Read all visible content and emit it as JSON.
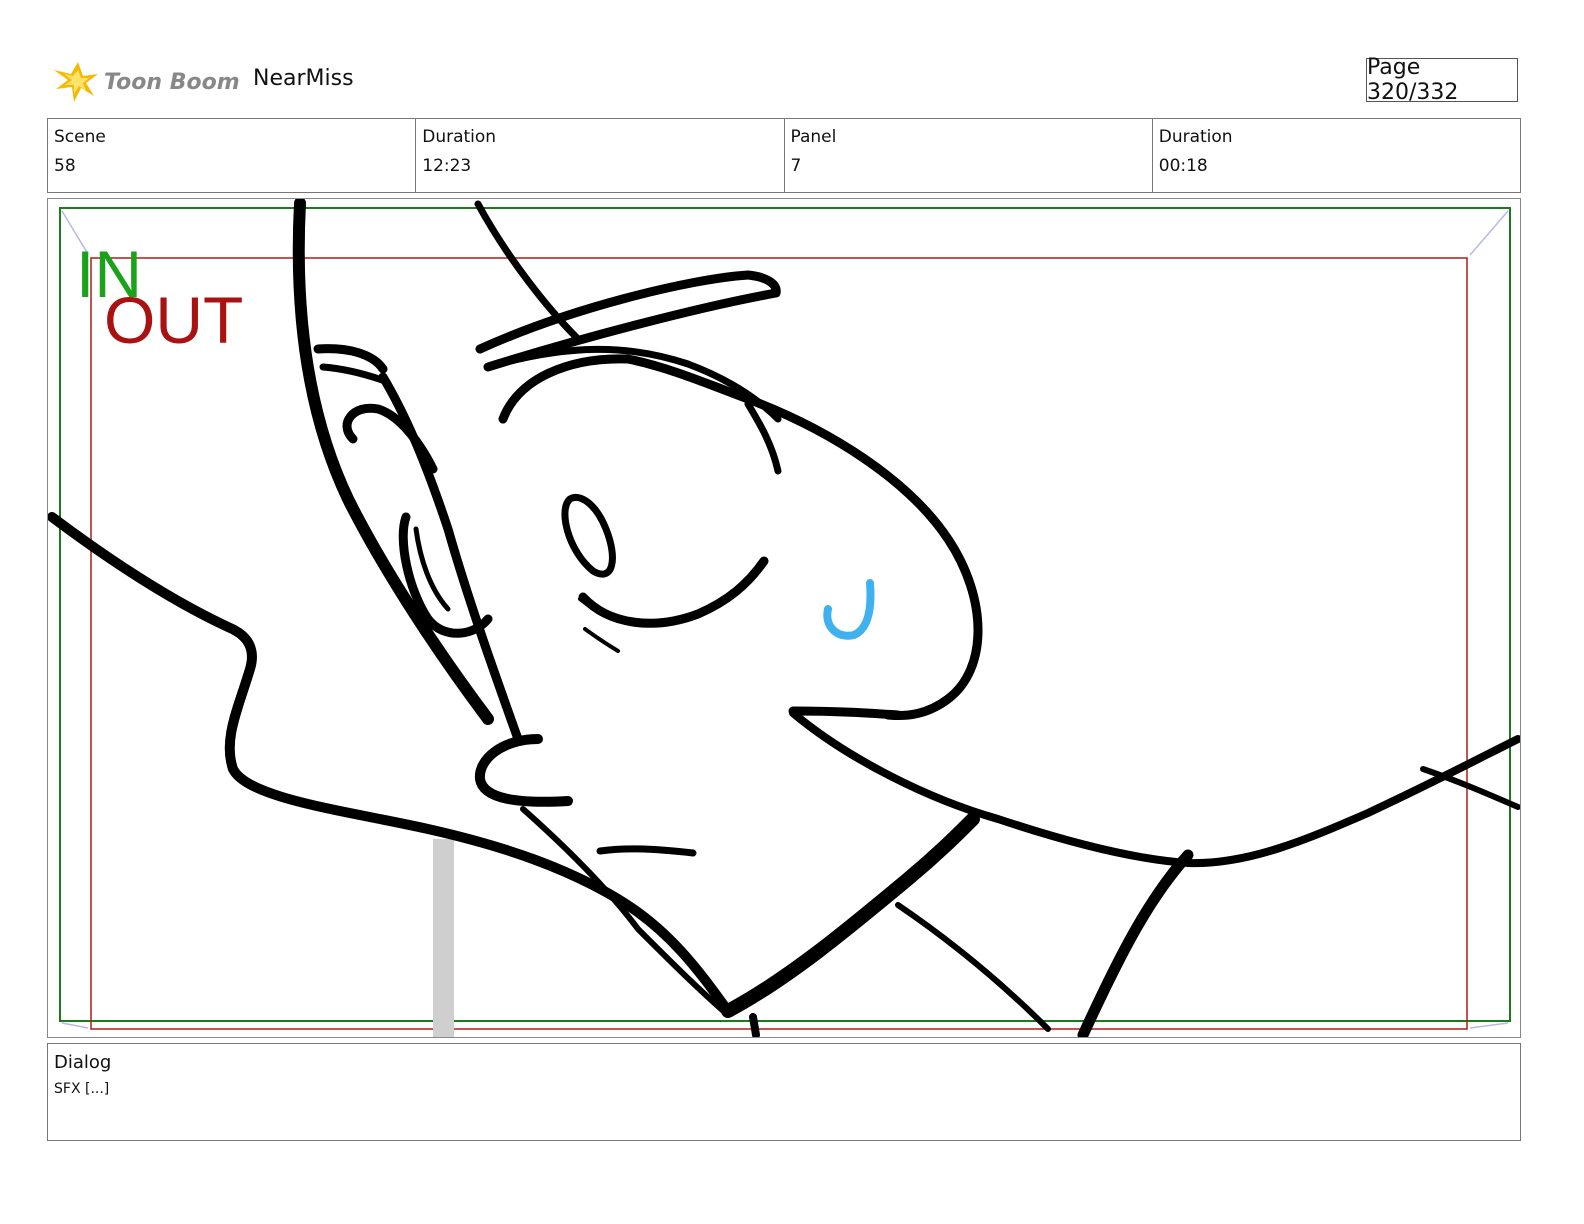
{
  "header": {
    "logo_text": "Toon Boom",
    "project_name": "NearMiss",
    "page_indicator": "Page 320/332"
  },
  "info": {
    "scene_label": "Scene",
    "scene_value": "58",
    "scene_duration_label": "Duration",
    "scene_duration_value": "12:23",
    "panel_label": "Panel",
    "panel_value": "7",
    "panel_duration_label": "Duration",
    "panel_duration_value": "00:18"
  },
  "panel": {
    "in_label": "IN",
    "out_label": "OUT",
    "in_color": "#1aa31a",
    "out_color": "#aa1111",
    "tear_color": "#3fb0f0"
  },
  "dialog": {
    "label": "Dialog",
    "text": "SFX [...]"
  }
}
